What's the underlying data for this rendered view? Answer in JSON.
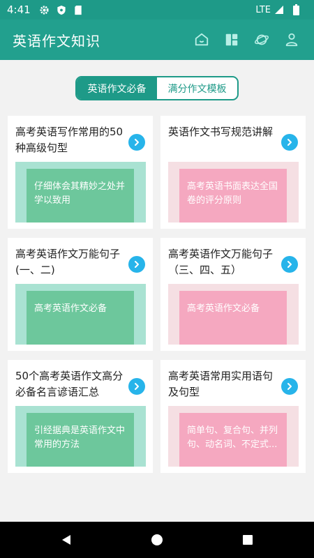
{
  "status": {
    "time": "4:41",
    "network": "LTE",
    "icons": [
      "gear-icon",
      "shield-icon",
      "sd-card-icon",
      "signal-icon",
      "battery-icon"
    ]
  },
  "appbar": {
    "title": "英语作文知识",
    "actions": [
      "home-icon",
      "dashboard-icon",
      "planet-icon",
      "person-icon"
    ]
  },
  "tabs": [
    {
      "label": "英语作文必备",
      "active": true
    },
    {
      "label": "满分作文模板",
      "active": false
    }
  ],
  "cards": [
    {
      "title": "高考英语写作常用的50种高级句型",
      "desc": "仔细体会其精妙之处并学以致用",
      "theme": "green"
    },
    {
      "title": "英语作文书写规范讲解",
      "desc": "高考英语书面表达全国卷的评分原则",
      "theme": "pink"
    },
    {
      "title": "高考英语作文万能句子(一、二)",
      "desc": "高考英语作文必备",
      "theme": "green"
    },
    {
      "title": "高考英语作文万能句子（三、四、五）",
      "desc": "高考英语作文必备",
      "theme": "pink"
    },
    {
      "title": "50个高考英语作文高分必备名言谚语汇总",
      "desc": "引经据典是英语作文中常用的方法",
      "theme": "green"
    },
    {
      "title": "高考英语常用实用语句及句型",
      "desc": "简单句、复合句、并列句、动名词、不定式...",
      "theme": "pink"
    }
  ],
  "colors": {
    "primary": "#22a08e",
    "status_bar": "#1e9a88",
    "arrow": "#27b4ea",
    "green_outer": "#a9e2d2",
    "green_inner": "#6dc79c",
    "pink_outer": "#f5dfe3",
    "pink_inner": "#f5a8c0"
  }
}
